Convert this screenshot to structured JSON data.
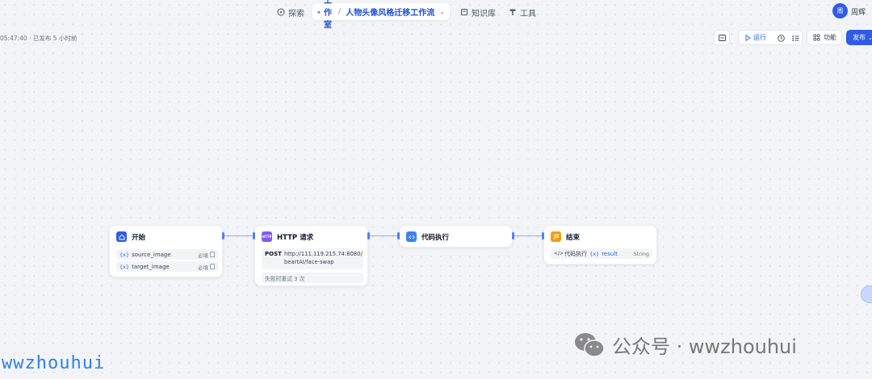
{
  "nav": {
    "explore": "探索",
    "studio": "工作室",
    "workflow_name": "人物头像风格迁移工作流",
    "knowledge": "知识库",
    "tools": "工具"
  },
  "user": {
    "avatar_text": "周",
    "name": "周辉"
  },
  "publish_info": "05:47:40 · 已发布 5 小时前",
  "toolbar": {
    "run": "运行",
    "features": "功能",
    "publish": "发布"
  },
  "nodes": {
    "start": {
      "title": "开始",
      "vars": [
        {
          "brace": "{x}",
          "name": "source_image",
          "req": "必填"
        },
        {
          "brace": "{x}",
          "name": "target_image",
          "req": "必填"
        }
      ]
    },
    "http": {
      "icon": "HTTP",
      "title": "HTTP 请求",
      "method": "POST",
      "url_line1": "http://111.119.215.74:8080/",
      "url_line2": "beartAI/face-swap",
      "retry": "失败时重试 3 次"
    },
    "code": {
      "title": "代码执行"
    },
    "end": {
      "title": "结束",
      "source": "代码执行",
      "brace": "{x}",
      "var": "result",
      "type": "String"
    }
  },
  "watermark": {
    "left": "wwzhouhui",
    "right": "公众号 · wwzhouhui"
  },
  "colors": {
    "accent": "#2f5be7",
    "start_icon": "#2f5be7",
    "http_icon": "#7c5cf2",
    "code_icon": "#3b82f6",
    "end_icon": "#f59e0b"
  }
}
